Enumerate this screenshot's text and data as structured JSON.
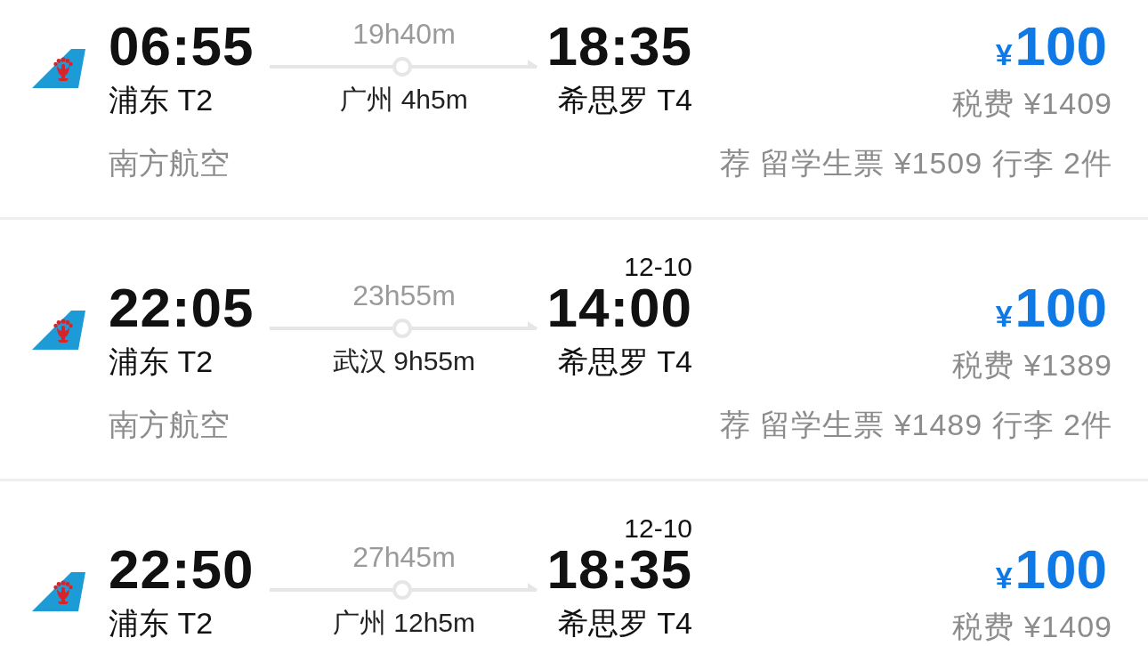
{
  "flights": [
    {
      "departure": {
        "time": "06:55",
        "airport": "浦东 T2"
      },
      "duration": "19h40m",
      "stopover": "广州 4h5m",
      "arrival": {
        "time": "18:35",
        "airport": "希思罗 T4"
      },
      "price": {
        "currency": "¥",
        "amount": "100"
      },
      "tax": "税费 ¥1409",
      "airline": "南方航空",
      "offer": "荐 留学生票 ¥1509 行李 2件"
    },
    {
      "departure": {
        "time": "22:05",
        "airport": "浦东 T2"
      },
      "duration": "23h55m",
      "stopover": "武汉 9h55m",
      "arrival": {
        "date": "12-10",
        "time": "14:00",
        "airport": "希思罗 T4"
      },
      "price": {
        "currency": "¥",
        "amount": "100"
      },
      "tax": "税费 ¥1389",
      "airline": "南方航空",
      "offer": "荐 留学生票 ¥1489 行李 2件"
    },
    {
      "departure": {
        "time": "22:50",
        "airport": "浦东 T2"
      },
      "duration": "27h45m",
      "stopover": "广州 12h5m",
      "arrival": {
        "date": "12-10",
        "time": "18:35",
        "airport": "希思罗 T4"
      },
      "price": {
        "currency": "¥",
        "amount": "100"
      },
      "tax": "税费 ¥1409"
    }
  ]
}
